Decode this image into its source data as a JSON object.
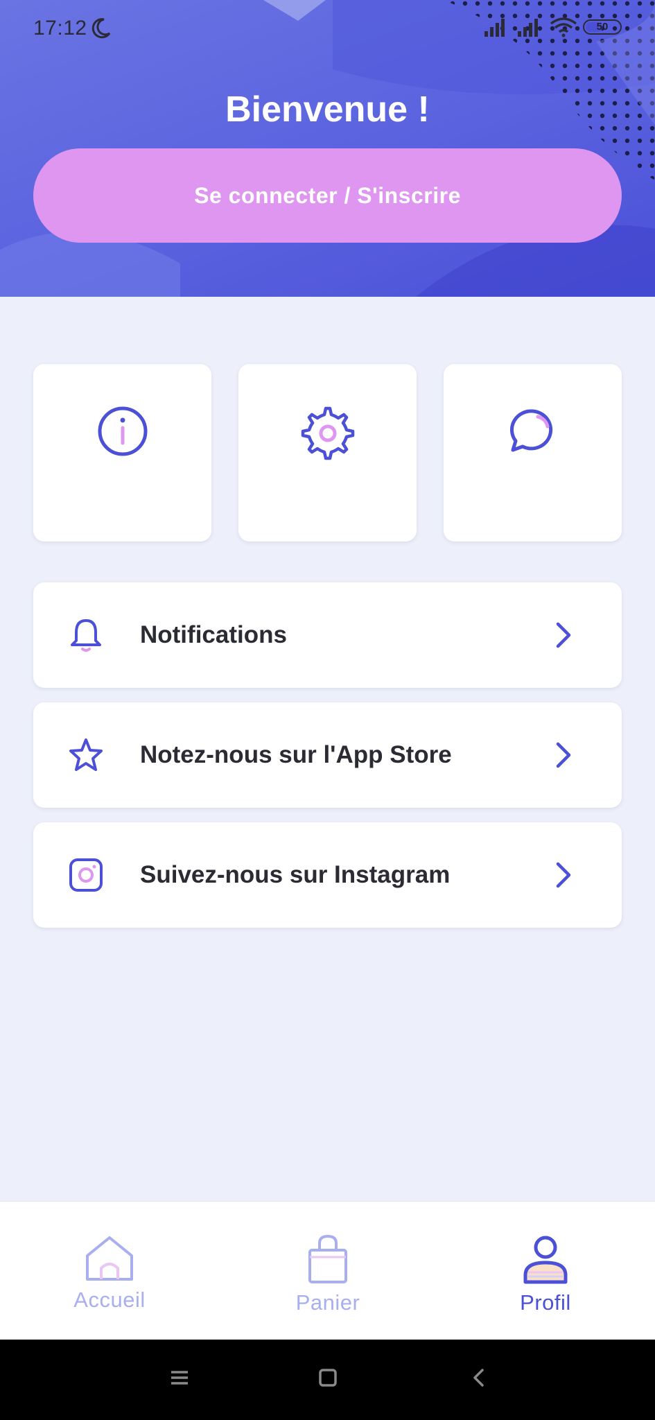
{
  "status_bar": {
    "time": "17:12",
    "battery": "50",
    "icons": [
      "moon-icon",
      "signal-icon",
      "signal-icon",
      "wifi-icon",
      "battery-icon"
    ]
  },
  "header": {
    "title": "Bienvenue !",
    "login_button": "Se connecter / S'inscrire"
  },
  "tiles": [
    {
      "icon": "info-icon"
    },
    {
      "icon": "gear-icon"
    },
    {
      "icon": "chat-bubble-icon"
    }
  ],
  "menu": [
    {
      "icon": "bell-icon",
      "label": "Notifications"
    },
    {
      "icon": "star-icon",
      "label": "Notez-nous sur l'App Store"
    },
    {
      "icon": "instagram-icon",
      "label": "Suivez-nous sur Instagram"
    }
  ],
  "bottom_nav": [
    {
      "icon": "home-icon",
      "label": "Accueil",
      "active": false
    },
    {
      "icon": "shopping-bag-icon",
      "label": "Panier",
      "active": false
    },
    {
      "icon": "user-icon",
      "label": "Profil",
      "active": true
    }
  ],
  "system_nav": [
    "menu-icon",
    "home-square-icon",
    "back-icon"
  ],
  "colors": {
    "primary": "#4b50d6",
    "accent_pink": "#df96f1",
    "background": "#edf0fa",
    "inactive_nav": "#a9aef0",
    "text": "#2b2b33"
  }
}
